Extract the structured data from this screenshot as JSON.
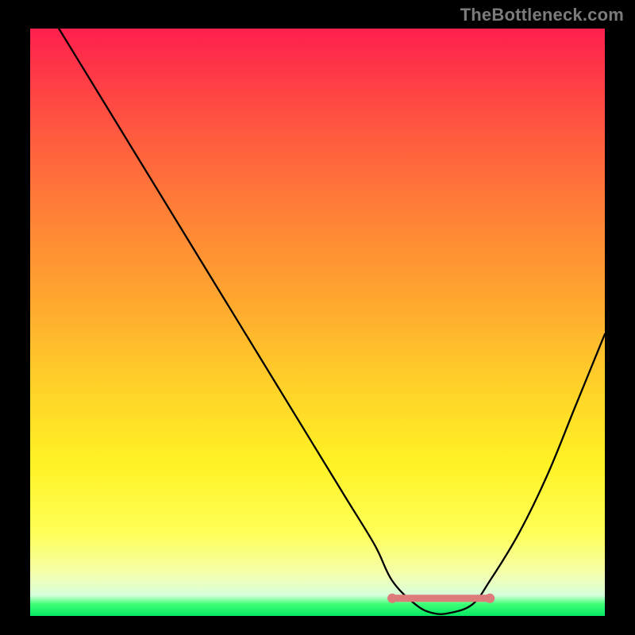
{
  "watermark": "TheBottleneck.com",
  "colors": {
    "background": "#000000",
    "curve": "#000000",
    "legend_band": "#dd7a7a",
    "gradient_top": "#ff1f4e",
    "gradient_bottom": "#06e763"
  },
  "chart_data": {
    "type": "line",
    "title": "",
    "xlabel": "",
    "ylabel": "",
    "xlim": [
      0,
      100
    ],
    "ylim": [
      0,
      100
    ],
    "series": [
      {
        "name": "bottleneck-curve",
        "x": [
          5,
          10,
          15,
          20,
          25,
          30,
          35,
          40,
          45,
          50,
          55,
          60,
          63,
          67,
          70,
          73,
          77,
          80,
          85,
          90,
          95,
          100
        ],
        "y": [
          100,
          92,
          84,
          76,
          68,
          60,
          52,
          44,
          36,
          28,
          20,
          12,
          6,
          2,
          0.5,
          0.5,
          2,
          6,
          14,
          24,
          36,
          48
        ]
      }
    ],
    "highlight_band": {
      "name": "optimal-range",
      "x_start": 63,
      "x_end": 80,
      "y": 3
    }
  }
}
